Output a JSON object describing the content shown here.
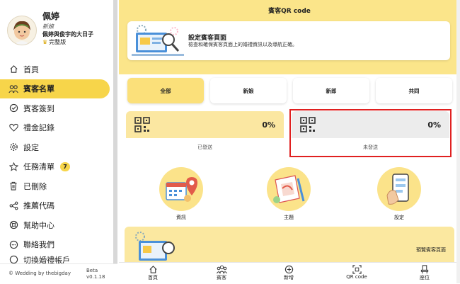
{
  "header": {
    "title": "賓客QR code"
  },
  "profile": {
    "name": "佩婷",
    "role": "新娘",
    "event": "佩婷與俊宇的大日子",
    "plan": "完整版"
  },
  "sidebar": {
    "items": [
      {
        "label": "首頁",
        "icon": "home-icon"
      },
      {
        "label": "賓客名單",
        "icon": "guests-icon",
        "active": true
      },
      {
        "label": "賓客簽到",
        "icon": "check-in-icon"
      },
      {
        "label": "禮金記錄",
        "icon": "heart-icon"
      },
      {
        "label": "設定",
        "icon": "gear-icon"
      },
      {
        "label": "任務清單",
        "icon": "star-icon",
        "badge": "7"
      },
      {
        "label": "已刪除",
        "icon": "trash-icon"
      },
      {
        "label": "推薦代碼",
        "icon": "share-icon"
      },
      {
        "label": "幫助中心",
        "icon": "help-icon"
      },
      {
        "label": "聯絡我們",
        "icon": "contact-icon"
      },
      {
        "label": "切換婚禮帳戶",
        "icon": "switch-icon"
      }
    ],
    "footer": {
      "copyright": "© Wedding by thebigday",
      "beta": "Beta",
      "version": "v0.1.18"
    }
  },
  "info_card": {
    "title": "設定賓客頁面",
    "description": "檢查和確保賓客頁面上的婚禮資訊以及導航正確。"
  },
  "tabs": [
    {
      "label": "全部",
      "active": true
    },
    {
      "label": "新娘"
    },
    {
      "label": "新郎"
    },
    {
      "label": "共同"
    }
  ],
  "stats": [
    {
      "percent": "0%",
      "label": "已發送"
    },
    {
      "percent": "0%",
      "label": "未發送"
    }
  ],
  "features": [
    {
      "label": "資訊"
    },
    {
      "label": "主題"
    },
    {
      "label": "設定"
    }
  ],
  "preview": {
    "label": "預覽賓客頁面"
  },
  "bottom_nav": [
    {
      "label": "首頁",
      "icon": "home-icon"
    },
    {
      "label": "賓客",
      "icon": "guests-icon"
    },
    {
      "label": "新增",
      "icon": "add-icon"
    },
    {
      "label": "QR code",
      "icon": "qr-icon"
    },
    {
      "label": "座位",
      "icon": "seat-icon"
    }
  ],
  "colors": {
    "accent": "#f7d54a",
    "header_bg": "#fbe58a",
    "highlight_border": "#e02020",
    "stat_sent_bg": "#fbe7a1",
    "stat_unsent_bg": "#ececec"
  }
}
